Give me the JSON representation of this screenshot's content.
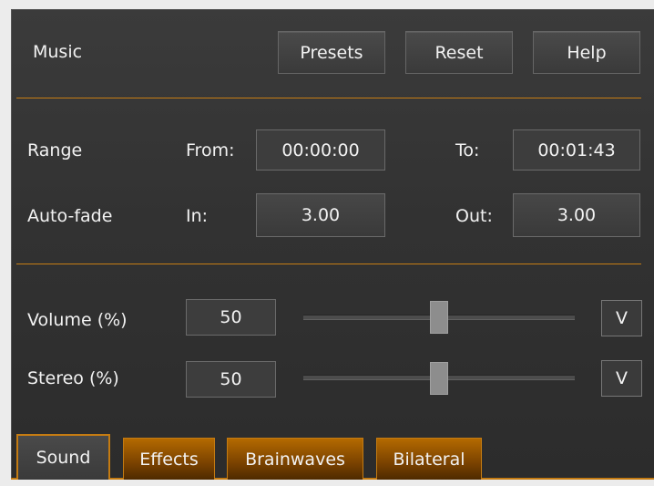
{
  "header": {
    "section_label": "Music",
    "presets_label": "Presets",
    "reset_label": "Reset",
    "help_label": "Help"
  },
  "range": {
    "label": "Range",
    "from_label": "From:",
    "from_value": "00:00:00",
    "to_label": "To:",
    "to_value": "00:01:43"
  },
  "autofade": {
    "label": "Auto-fade",
    "in_label": "In:",
    "in_value": "3.00",
    "out_label": "Out:",
    "out_value": "3.00"
  },
  "volume": {
    "label": "Volume (%)",
    "value": "50",
    "slider_fraction": 0.5,
    "v_button_label": "V"
  },
  "stereo": {
    "label": "Stereo (%)",
    "value": "50",
    "slider_fraction": 0.5,
    "v_button_label": "V"
  },
  "tabs": [
    {
      "label": "Sound",
      "active": true
    },
    {
      "label": "Effects",
      "active": false
    },
    {
      "label": "Brainwaves",
      "active": false
    },
    {
      "label": "Bilateral",
      "active": false
    }
  ],
  "colors": {
    "accent": "#c77d14",
    "panel_background": "#333333"
  }
}
